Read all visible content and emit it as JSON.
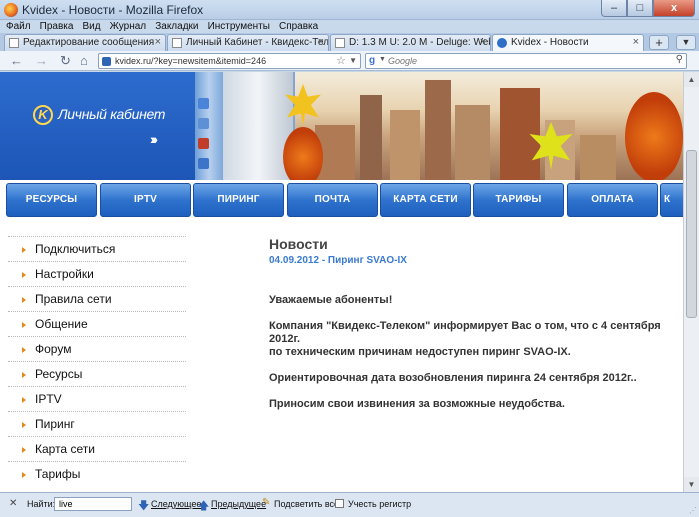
{
  "window": {
    "title": "Kvidex - Новости - Mozilla Firefox",
    "buttons": {
      "minimize": "–",
      "maximize": "□",
      "close": "x"
    }
  },
  "menu": [
    "Файл",
    "Правка",
    "Вид",
    "Журнал",
    "Закладки",
    "Инструменты",
    "Справка"
  ],
  "tabs": [
    {
      "label": "Редактирование сообщения"
    },
    {
      "label": "Личный Кабинет - Квидекс-Телеко..."
    },
    {
      "label": "D: 1.3 M U: 2.0 M - Deluge: Web UI 1...."
    },
    {
      "label": "Kvidex - Новости",
      "active": true
    }
  ],
  "navbar": {
    "url": "kvidex.ru/?key=newsitem&itemid=246",
    "search_placeholder": "Google"
  },
  "banner": {
    "logo_letter": "K",
    "logo_text": "Личный кабинет",
    "logo_arrows": "›››"
  },
  "site_nav": [
    "РЕСУРСЫ",
    "IPTV",
    "ПИРИНГ",
    "ПОЧТА",
    "КАРТА СЕТИ",
    "ТАРИФЫ",
    "ОПЛАТА",
    "К"
  ],
  "sidebar": [
    "Подключиться",
    "Настройки",
    "Правила сети",
    "Общение",
    "Форум",
    "Ресурсы",
    "IPTV",
    "Пиринг",
    "Карта сети",
    "Тарифы"
  ],
  "news": {
    "title": "Новости",
    "date_line": "04.09.2012 - Пиринг SVAO-IX",
    "greeting": "Уважаемые абоненты!",
    "p1_line1": "Компания \"Квидекс-Телеком\" информирует Вас о том, что с 4 сентября 2012г.",
    "p1_line2": "по техническим причинам недоступен пиринг SVAO-IX.",
    "p2": "Ориентировочная дата возобновления пиринга 24 сентября 2012г..",
    "p3": "Приносим свои извинения за возможные неудобства."
  },
  "findbar": {
    "label": "Найти:",
    "value": "live",
    "next": "Следующее",
    "prev": "Предыдущее",
    "highlight": "Подсветить все",
    "match_case": "Учесть регистр"
  }
}
